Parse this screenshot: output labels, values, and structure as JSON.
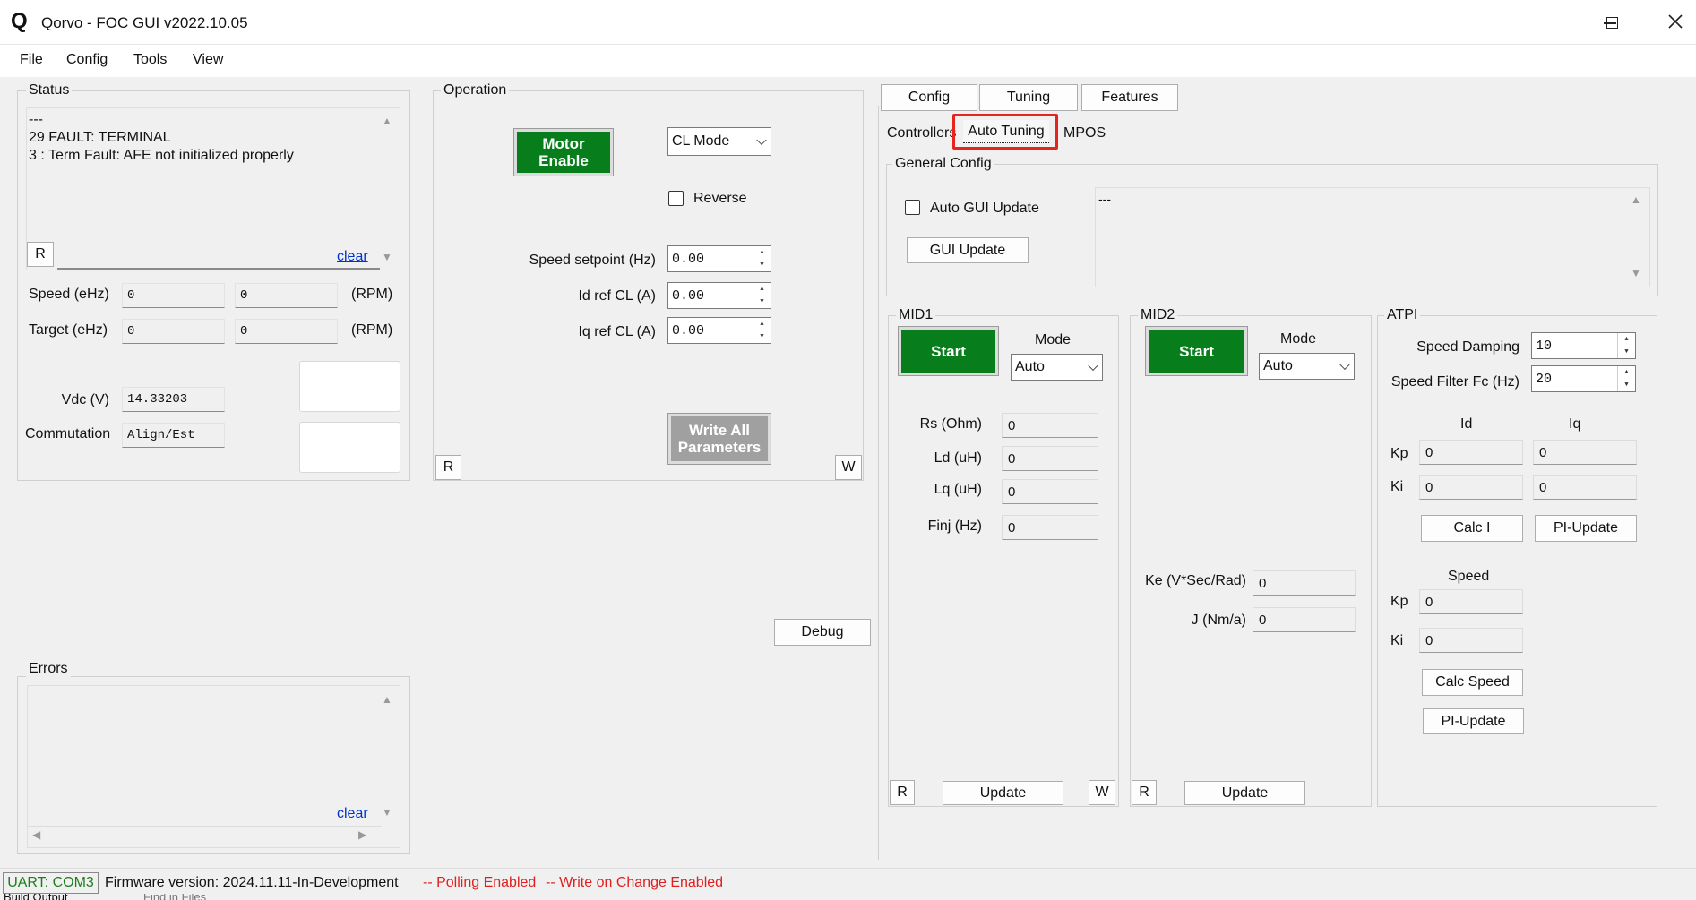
{
  "window": {
    "title": "Qorvo - FOC GUI v2022.10.05",
    "logo_letter": "Q"
  },
  "menu": [
    "File",
    "Config",
    "Tools",
    "View"
  ],
  "status": {
    "legend": "Status",
    "log_lines": [
      "---",
      "29 FAULT: TERMINAL",
      "3 : Term Fault: AFE not initialized properly"
    ],
    "r_label": "R",
    "clear_label": "clear",
    "speed_label": "Speed (eHz)",
    "speed_val1": "0",
    "speed_val2": "0",
    "speed_unit": "(RPM)",
    "target_label": "Target (eHz)",
    "target_val1": "0",
    "target_val2": "0",
    "target_unit": "(RPM)",
    "vdc_label": "Vdc (V)",
    "vdc_val": "14.33203",
    "comm_label": "Commutation",
    "comm_val": "Align/Est"
  },
  "operation": {
    "legend": "Operation",
    "motor_enable": "Motor Enable",
    "mode_value": "CL Mode",
    "reverse_label": "Reverse",
    "speed_sp_label": "Speed setpoint (Hz)",
    "speed_sp_val": "0.00",
    "id_ref_label": "Id ref CL (A)",
    "id_ref_val": "0.00",
    "iq_ref_label": "Iq ref CL (A)",
    "iq_ref_val": "0.00",
    "write_all": "Write All Parameters",
    "r_label": "R",
    "w_label": "W"
  },
  "debug_label": "Debug",
  "errors": {
    "legend": "Errors",
    "clear_label": "clear"
  },
  "tabs": {
    "top": [
      "Config",
      "Tuning",
      "Features"
    ],
    "sub": [
      "Controllers",
      "Auto Tuning",
      "MPOS"
    ],
    "highlight_color": "#e8231d"
  },
  "general_config": {
    "legend": "General Config",
    "auto_gui_update": "Auto GUI Update",
    "gui_update": "GUI Update",
    "text": "---"
  },
  "mid1": {
    "legend": "MID1",
    "start": "Start",
    "mode_label": "Mode",
    "mode_value": "Auto",
    "rs_label": "Rs (Ohm)",
    "rs_val": "0",
    "ld_label": "Ld (uH)",
    "ld_val": "0",
    "lq_label": "Lq (uH)",
    "lq_val": "0",
    "finj_label": "Finj (Hz)",
    "finj_val": "0",
    "r_label": "R",
    "update": "Update",
    "w_label": "W"
  },
  "mid2": {
    "legend": "MID2",
    "start": "Start",
    "mode_label": "Mode",
    "mode_value": "Auto",
    "ke_label": "Ke (V*Sec/Rad)",
    "ke_val": "0",
    "j_label": "J (Nm/a)",
    "j_val": "0",
    "r_label": "R",
    "update": "Update"
  },
  "atpi": {
    "legend": "ATPI",
    "speed_damping_label": "Speed Damping",
    "speed_damping_val": "10",
    "speed_filter_label": "Speed Filter Fc (Hz)",
    "speed_filter_val": "20",
    "id_header": "Id",
    "iq_header": "Iq",
    "kp_label": "Kp",
    "ki_label": "Ki",
    "kp_id": "0",
    "kp_iq": "0",
    "ki_id": "0",
    "ki_iq": "0",
    "calc_i": "Calc I",
    "pi_update": "PI-Update",
    "speed_header": "Speed",
    "speed_kp": "0",
    "speed_ki": "0",
    "calc_speed": "Calc Speed",
    "pi_update2": "PI-Update"
  },
  "statusbar": {
    "uart": "UART: COM3",
    "firmware": "Firmware version: 2024.11.11-In-Development",
    "polling": "-- Polling Enabled",
    "write_change": "-- Write on Change Enabled",
    "uart_color": "#1a7f1a",
    "warn_color": "#e02020"
  },
  "bottom_tabs": [
    "Build Output",
    "Find in Files"
  ]
}
